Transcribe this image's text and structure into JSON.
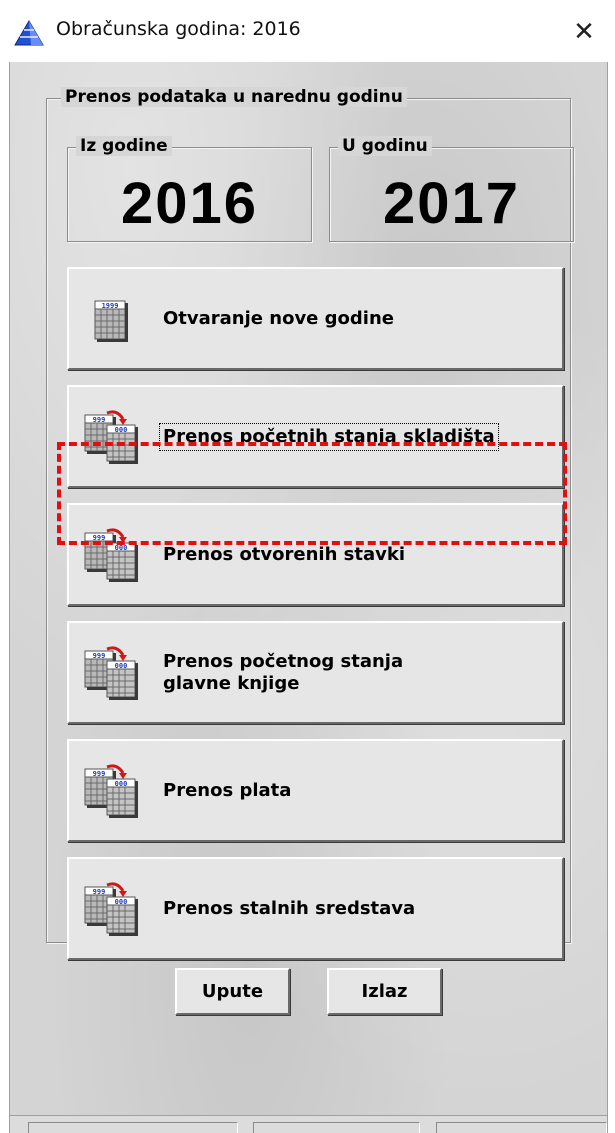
{
  "window": {
    "title": "Obračunska godina: 2016",
    "close_glyph": "✕",
    "app_icon": "blue-pyramid-icon"
  },
  "group": {
    "title": "Prenos podataka u narednu godinu",
    "from_year": {
      "label": "Iz godine",
      "value": "2016"
    },
    "to_year": {
      "label": "U godinu",
      "value": "2017"
    }
  },
  "actions": [
    {
      "label": "Otvaranje nove godine",
      "icon": "calendar-icon"
    },
    {
      "label": "Prenos početnih stanja skladišta",
      "icon": "calendar-transfer-icon",
      "focused": true
    },
    {
      "label": "Prenos otvorenih stavki",
      "icon": "calendar-transfer-icon",
      "highlighted": true
    },
    {
      "label": "Prenos početnog stanja glavne knjige",
      "icon": "calendar-transfer-icon"
    },
    {
      "label": "Prenos plata",
      "icon": "calendar-transfer-icon"
    },
    {
      "label": "Prenos stalnih sredstava",
      "icon": "calendar-transfer-icon"
    }
  ],
  "footer": {
    "help_label": "Upute",
    "exit_label": "Izlaz"
  },
  "colors": {
    "highlight": "#e01010",
    "background": "#d4d4d4",
    "button_face": "#e6e6e6"
  }
}
